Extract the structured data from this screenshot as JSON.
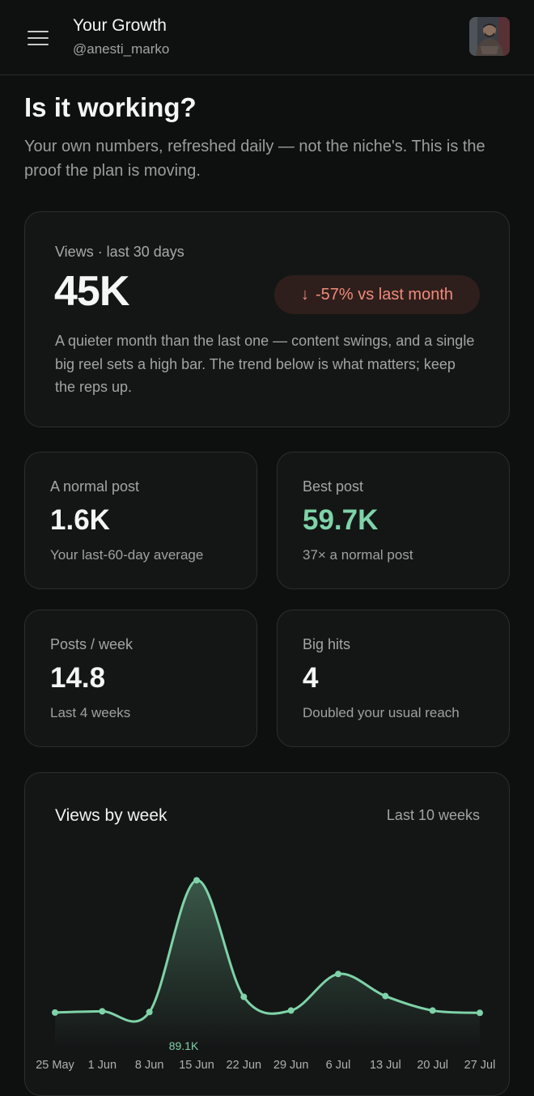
{
  "header": {
    "title": "Your Growth",
    "handle": "@anesti_marko",
    "menu_icon": "hamburger-menu-icon",
    "avatar_icon": "user-avatar"
  },
  "intro": {
    "heading": "Is it working?",
    "subtitle": "Your own numbers, refreshed daily — not the niche's. This is the proof the plan is moving."
  },
  "hero": {
    "label": "Views · last 30 days",
    "value": "45K",
    "change_arrow": "↓",
    "change_text": "-57% vs last month",
    "description": "A quieter month than the last one — content swings, and a single big reel sets a high bar. The trend below is what matters; keep the reps up."
  },
  "stats": [
    {
      "label": "A normal post",
      "value": "1.6K",
      "note": "Your last-60-day average"
    },
    {
      "label": "Best post",
      "value": "59.7K",
      "note": "37× a normal post"
    },
    {
      "label": "Posts / week",
      "value": "14.8",
      "note": "Last 4 weeks"
    },
    {
      "label": "Big hits",
      "value": "4",
      "note": "Doubled your usual reach"
    }
  ],
  "colors": {
    "accent_green": "#7fd3a8",
    "negative": "#f08a7a",
    "card_bg": "#141616",
    "page_bg": "#0e0f0f"
  },
  "chart_data": {
    "type": "area",
    "title": "Views by week",
    "range_label": "Last 10 weeks",
    "categories": [
      "25 May",
      "1 Jun",
      "8 Jun",
      "15 Jun",
      "22 Jun",
      "29 Jun",
      "6 Jul",
      "13 Jul",
      "20 Jul",
      "27 Jul"
    ],
    "series": [
      {
        "values": [
          2200,
          3000,
          2500,
          89100,
          12500,
          3500,
          27500,
          13000,
          3500,
          2000
        ]
      }
    ],
    "annotations": [
      {
        "category": "15 Jun",
        "text": "89.1K"
      }
    ],
    "ylim": [
      0,
      100000
    ],
    "grid": false
  }
}
